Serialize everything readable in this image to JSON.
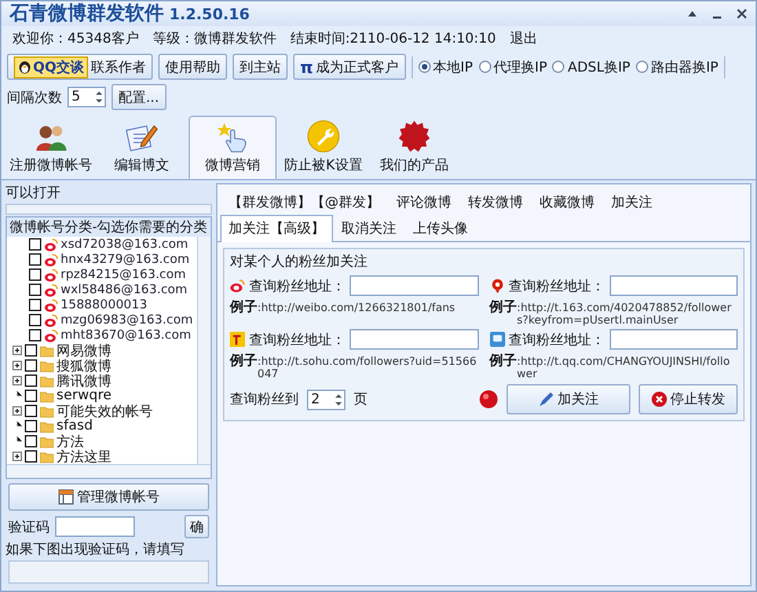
{
  "window": {
    "title": "石青微博群发软件",
    "version": "1.2.50.16"
  },
  "info_bar": {
    "welcome": "欢迎你：45348客户",
    "level": "等级：微博群发软件",
    "end_time": "结束时间:2110-06-12 14:10:10",
    "logout": "退出"
  },
  "toolbar": {
    "buttons": [
      {
        "kind": "qq",
        "badge": "QQ交谈",
        "label": "联系作者"
      },
      {
        "kind": "plain",
        "label": "使用帮助"
      },
      {
        "kind": "plain",
        "label": "到主站"
      },
      {
        "kind": "pi",
        "symbol": "π",
        "label": "成为正式客户"
      }
    ],
    "ip_modes": [
      {
        "label": "本地IP",
        "selected": true
      },
      {
        "label": "代理换IP",
        "selected": false
      },
      {
        "label": "ADSL换IP",
        "selected": false
      },
      {
        "label": "路由器换IP",
        "selected": false
      }
    ],
    "interval": {
      "label": "间隔次数",
      "value": "5"
    },
    "config_button": "配置..."
  },
  "ribbon": [
    {
      "kind": "people",
      "label": "注册微博帐号",
      "selected": false
    },
    {
      "kind": "edit",
      "label": "编辑博文",
      "selected": false
    },
    {
      "kind": "hand",
      "label": "微博营销",
      "selected": true
    },
    {
      "kind": "wrench",
      "label": "防止被K设置",
      "selected": false
    },
    {
      "kind": "new",
      "label": "我们的产品",
      "selected": false
    }
  ],
  "left_panel": {
    "status": "可以打开",
    "progress": {
      "level": 0
    },
    "tree": {
      "title": "微博帐号分类-勾选你需要的分类",
      "accounts": [
        {
          "label": "xsd72038@163.com",
          "checked": false
        },
        {
          "label": "hnx43279@163.com",
          "checked": false
        },
        {
          "label": "rpz84215@163.com",
          "checked": false
        },
        {
          "label": "wxl58486@163.com",
          "checked": false
        },
        {
          "label": "15888000013",
          "checked": false
        },
        {
          "label": "mzg06983@163.com",
          "checked": false
        },
        {
          "label": "mht83670@163.com",
          "checked": false
        }
      ],
      "categories": [
        {
          "label": "网易微博",
          "checked": false,
          "expandable": true
        },
        {
          "label": "搜狐微博",
          "checked": false,
          "expandable": true
        },
        {
          "label": "腾讯微博",
          "checked": false,
          "expandable": true
        },
        {
          "label": "serwqre",
          "checked": false,
          "expandable": false
        },
        {
          "label": "可能失效的帐号",
          "checked": false,
          "expandable": true
        },
        {
          "label": "sfasd",
          "checked": false,
          "expandable": false
        },
        {
          "label": "方法",
          "checked": false,
          "expandable": false
        },
        {
          "label": "方法这里",
          "checked": false,
          "expandable": true
        }
      ]
    },
    "manage_button": "管理微博帐号",
    "captcha": {
      "label": "验证码",
      "confirm": "确",
      "hint": "如果下图出现验证码，请填写"
    }
  },
  "tabs": [
    {
      "label": "【群发微博】【@群发】",
      "selected": false
    },
    {
      "label": "评论微博",
      "selected": false
    },
    {
      "label": "转发微博",
      "selected": false
    },
    {
      "label": "收藏微博",
      "selected": false
    },
    {
      "label": "加关注",
      "selected": false
    },
    {
      "label": "加关注【高级】",
      "selected": true
    },
    {
      "label": "取消关注",
      "selected": false
    },
    {
      "label": "上传头像",
      "selected": false
    }
  ],
  "follow_panel": {
    "title": "对某个人的粉丝加关注",
    "queries": [
      {
        "kind": "sina",
        "label": "查询粉丝地址：",
        "example_label": "例子",
        "example": ":http://weibo.com/1266321801/fans"
      },
      {
        "kind": "netease",
        "label": "查询粉丝地址：",
        "example_label": "例子",
        "example": ":http://t.163.com/4020478852/followers?keyfrom=pUsertl.mainUser"
      },
      {
        "kind": "sohu",
        "label": "查询粉丝地址：",
        "example_label": "例子",
        "example": ":http://t.sohu.com/followers?uid=51566047"
      },
      {
        "kind": "qq",
        "label": "查询粉丝地址：",
        "example_label": "例子",
        "example": ":http://t.qq.com/CHANGYOUJINSHI/follower"
      }
    ],
    "pages": {
      "label": "查询粉丝到",
      "value": "2",
      "unit": "页"
    },
    "follow_button": "加关注",
    "stop_button": "停止转发"
  }
}
